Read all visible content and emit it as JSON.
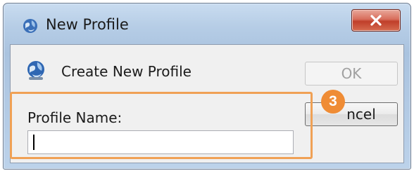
{
  "window": {
    "title": "New Profile",
    "close_icon": "close-icon"
  },
  "dialog": {
    "header_text": "Create New Profile",
    "header_icon": "profile-globe-icon",
    "ok_label": "OK",
    "cancel_label": "ncel",
    "profile_name_label": "Profile Name:",
    "profile_name_value": ""
  },
  "annotation": {
    "step_number": "3",
    "highlight_color": "#f0a155",
    "badge_color": "#ef8c35"
  }
}
